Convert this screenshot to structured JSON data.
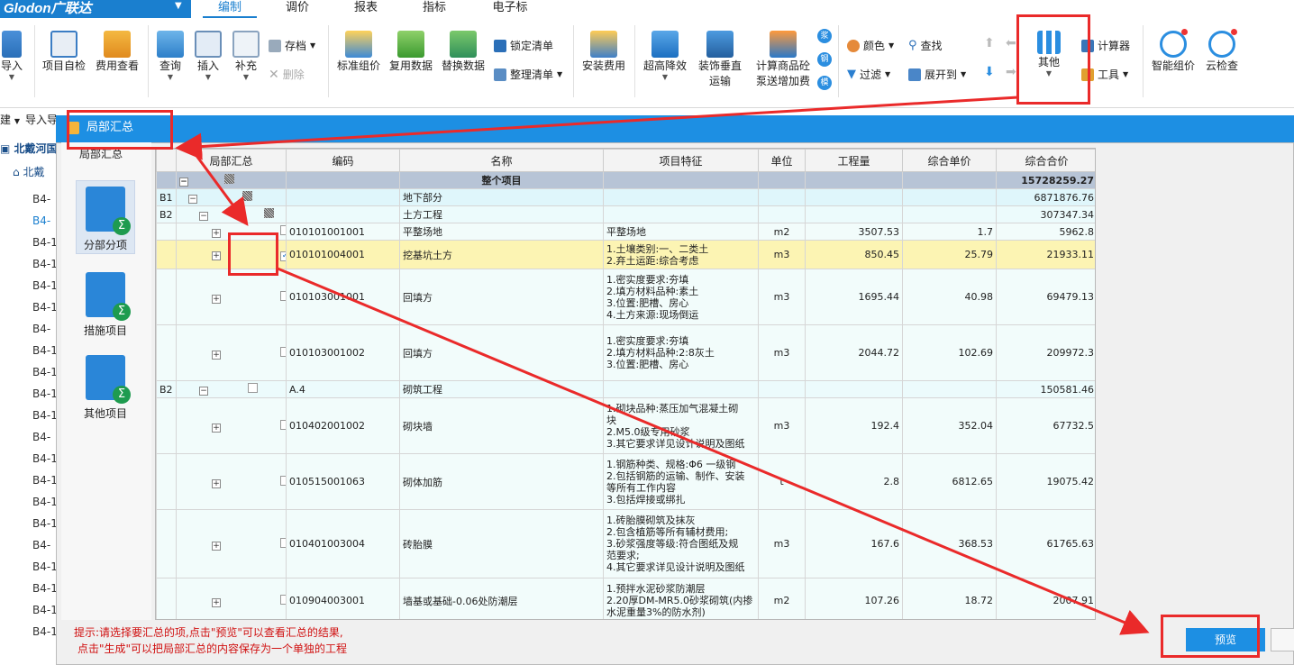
{
  "app": {
    "logo": "Glodon广联达"
  },
  "menu_tabs": [
    "编制",
    "调价",
    "报表",
    "指标",
    "电子标"
  ],
  "ribbon": {
    "import": "导入",
    "self_check": "项目自检",
    "fee_view": "费用查看",
    "query": "查询",
    "insert": "插入",
    "supplement": "补充",
    "archive": "存档",
    "delete": "删除",
    "std_price": "标准组价",
    "reuse_data": "复用数据",
    "replace_data": "替换数据",
    "lock_list": "锁定清单",
    "organize_list": "整理清单",
    "install_fee": "安装费用",
    "high_rise": "超高降效",
    "vertical_trans_1": "装饰垂直",
    "vertical_trans_2": "运输",
    "concrete_1": "计算商品砼",
    "concrete_2": "泵送增加费",
    "side_chars": [
      "浆",
      "钢",
      "模"
    ],
    "color": "颜色",
    "find": "查找",
    "filter": "过滤",
    "expand": "展开到",
    "other": "其他",
    "calculator": "计算器",
    "tools": "工具",
    "smart_price": "智能组价",
    "cloud_check": "云检查"
  },
  "left_tree": {
    "header1": "建",
    "header2": "导入导",
    "root": "北戴河国",
    "sub": "北戴",
    "items": [
      "B4-",
      "B4-",
      "B4-1",
      "B4-1",
      "B4-1",
      "B4-1",
      "B4-",
      "B4-1",
      "B4-1",
      "B4-1",
      "B4-1",
      "B4-",
      "B4-1",
      "B4-1",
      "B4-1",
      "B4-1",
      "B4-",
      "B4-1",
      "B4-1",
      "B4-1",
      "B4-1"
    ]
  },
  "dialog": {
    "title": "局部汇总",
    "side_header": "局部汇总",
    "side_items": [
      "分部分项",
      "措施项目",
      "其他项目"
    ],
    "columns": [
      "局部汇总",
      "编码",
      "名称",
      "项目特征",
      "单位",
      "工程量",
      "综合单价",
      "综合合价"
    ],
    "rows": [
      {
        "lvl": "",
        "code": "",
        "name": "整个项目",
        "feat": [],
        "unit": "",
        "qty": "",
        "price": "",
        "total": "15728259.27"
      },
      {
        "lvl": "B1",
        "code": "",
        "name": "地下部分",
        "feat": [],
        "unit": "",
        "qty": "",
        "price": "",
        "total": "6871876.76"
      },
      {
        "lvl": "B2",
        "code": "",
        "name": "土方工程",
        "feat": [],
        "unit": "",
        "qty": "",
        "price": "",
        "total": "307347.34"
      },
      {
        "lvl": "",
        "code": "010101001001",
        "name": "平整场地",
        "feat": [
          "平整场地"
        ],
        "unit": "m2",
        "qty": "3507.53",
        "price": "1.7",
        "total": "5962.8"
      },
      {
        "lvl": "",
        "code": "010101004001",
        "name": "挖基坑土方",
        "feat": [
          "1.土壤类别:一、二类土",
          "2.弃土运距:综合考虑"
        ],
        "unit": "m3",
        "qty": "850.45",
        "price": "25.79",
        "total": "21933.11"
      },
      {
        "lvl": "",
        "code": "010103001001",
        "name": "回填方",
        "feat": [
          "1.密实度要求:夯填",
          "2.填方材料品种:素土",
          "3.位置:肥槽、房心",
          "4.土方来源:现场倒运"
        ],
        "unit": "m3",
        "qty": "1695.44",
        "price": "40.98",
        "total": "69479.13"
      },
      {
        "lvl": "",
        "code": "010103001002",
        "name": "回填方",
        "feat": [
          "1.密实度要求:夯填",
          "2.填方材料品种:2:8灰土",
          "3.位置:肥槽、房心"
        ],
        "unit": "m3",
        "qty": "2044.72",
        "price": "102.69",
        "total": "209972.3"
      },
      {
        "lvl": "B2",
        "code": "A.4",
        "name": "砌筑工程",
        "feat": [],
        "unit": "",
        "qty": "",
        "price": "",
        "total": "150581.46"
      },
      {
        "lvl": "",
        "code": "010402001002",
        "name": "砌块墙",
        "feat": [
          "1.砌块品种:蒸压加气混凝土砌",
          "块",
          "2.M5.0级专用砂浆",
          "3.其它要求详见设计说明及图纸"
        ],
        "unit": "m3",
        "qty": "192.4",
        "price": "352.04",
        "total": "67732.5"
      },
      {
        "lvl": "",
        "code": "010515001063",
        "name": "砌体加筋",
        "feat": [
          "1.钢筋种类、规格:Φ6 一级钢",
          "2.包括钢筋的运输、制作、安装",
          "等所有工作内容",
          "3.包括焊接或绑扎"
        ],
        "unit": "t",
        "qty": "2.8",
        "price": "6812.65",
        "total": "19075.42"
      },
      {
        "lvl": "",
        "code": "010401003004",
        "name": "砖胎膜",
        "feat": [
          "1.砖胎膜砌筑及抹灰",
          "2.包含植筋等所有辅材费用;",
          "3.砂浆强度等级:符合图纸及规",
          "范要求;",
          "4.其它要求详见设计说明及图纸"
        ],
        "unit": "m3",
        "qty": "167.6",
        "price": "368.53",
        "total": "61765.63"
      },
      {
        "lvl": "",
        "code": "010904003001",
        "name": "墙基或基础-0.06处防潮层",
        "feat": [
          "1.预拌水泥砂浆防潮层",
          "2.20厚DM-MR5.0砂浆砌筑(内掺",
          "水泥重量3%的防水剂)"
        ],
        "unit": "m2",
        "qty": "107.26",
        "price": "18.72",
        "total": "2007.91"
      }
    ],
    "hint_line1": "提示:请选择要汇总的项,点击\"预览\"可以查看汇总的结果,",
    "hint_line2": "点击\"生成\"可以把局部汇总的内容保存为一个单独的工程",
    "preview_btn": "预览"
  }
}
